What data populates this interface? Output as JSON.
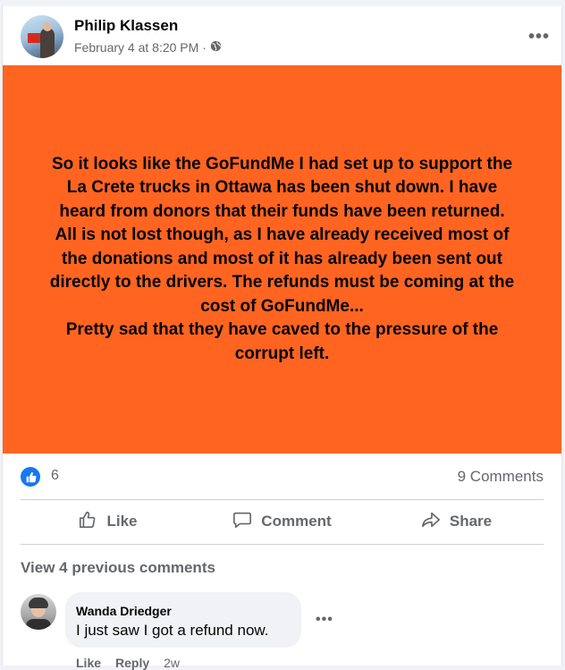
{
  "post": {
    "author": "Philip Klassen",
    "date": "February 4 at 8:20 PM",
    "separator": "·",
    "privacy_icon": "globe-icon",
    "banner_color": "#ff6421",
    "body": "So it looks like the GoFundMe I had set up to support the\nLa Crete trucks in Ottawa has been shut down. I have\nheard from donors that their funds have been returned.\nAll is not lost though, as I have already received most of\nthe donations and most of it has already been sent out\ndirectly to the drivers. The refunds must be coming at the\ncost of GoFundMe...\nPretty sad that they have caved to the pressure of the\ncorrupt left."
  },
  "stats": {
    "likes": "6",
    "comments": "9 Comments"
  },
  "actions": {
    "like": "Like",
    "comment": "Comment",
    "share": "Share"
  },
  "comments_section": {
    "view_previous": "View 4 previous comments",
    "items": [
      {
        "author": "Wanda Driedger",
        "text": "I just saw I got a refund now.",
        "like_label": "Like",
        "reply_label": "Reply",
        "time": "2w"
      }
    ]
  },
  "colors": {
    "accent": "#1877f2",
    "muted_text": "#65676b",
    "bubble_bg": "#f0f2f5"
  }
}
